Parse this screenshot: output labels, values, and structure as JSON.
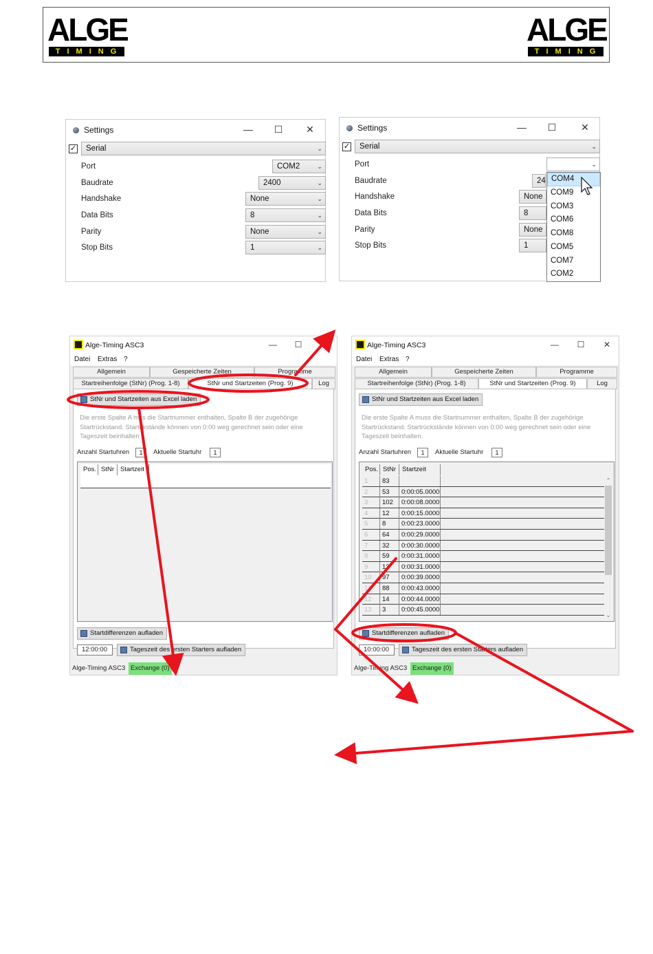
{
  "brand": {
    "logo_word": "ALGE",
    "logo_sub": "TIMING"
  },
  "settings_left": {
    "title": "Settings",
    "connection": "Serial",
    "port_label": "Port",
    "port_value": "COM2",
    "baud_label": "Baudrate",
    "baud_value": "2400",
    "handshake_label": "Handshake",
    "handshake_value": "None",
    "databits_label": "Data Bits",
    "databits_value": "8",
    "parity_label": "Parity",
    "parity_value": "None",
    "stopbits_label": "Stop Bits",
    "stopbits_value": "1"
  },
  "settings_right": {
    "title": "Settings",
    "connection": "Serial",
    "port_label": "Port",
    "port_value": "",
    "baud_label": "Baudrate",
    "baud_value": "24",
    "handshake_label": "Handshake",
    "handshake_value": "None",
    "databits_label": "Data Bits",
    "databits_value": "8",
    "parity_label": "Parity",
    "parity_value": "None",
    "stopbits_label": "Stop Bits",
    "stopbits_value": "1",
    "port_options": [
      "COM4",
      "COM9",
      "COM3",
      "COM6",
      "COM8",
      "COM5",
      "COM7",
      "COM2"
    ],
    "port_selected": "COM4"
  },
  "asc3": {
    "title": "Alge-Timing ASC3",
    "menu": [
      "Datei",
      "Extras",
      "?"
    ],
    "tabs_top": [
      "Allgemein",
      "Gespeicherte Zeiten",
      "Programme"
    ],
    "tabs_bottom": [
      "Startreihenfolge (StNr) (Prog. 1-8)",
      "StNr und Startzeiten (Prog. 9)",
      "Log"
    ],
    "load_excel": "StNr und Startzeiten aus Excel laden",
    "info_text": "Die erste Spalte A muss die Startnummer enthalten, Spalte B der zugehörige Startrückstand. Startrückstände können von 0:00 weg gerechnet sein oder eine Tageszeit beinhalten.",
    "starter_count_label": "Anzahl Startuhren",
    "starter_count_value": "1",
    "current_starter_label": "Aktuelle Startuhr",
    "current_starter_value": "1",
    "col_pos": "Pos.",
    "col_stnr": "StNr",
    "col_time": "Startzeit",
    "upload_diffs": "Startdifferenzen aufladen",
    "upload_daytime": "Tageszeit des ersten Starters aufladen",
    "status_app": "Alge-Timing ASC3",
    "status_exchange": "Exchange (0)"
  },
  "asc_left": {
    "time_value": "12:00:00",
    "info_partial_1": "Die erste Spalte A m",
    "info_partial_2": "ss die Startnummer enthalten, Spalte B der zugehörige",
    "info_partial_3": "Startrückstand. Start",
    "info_partial_4": "ckstände können von 0:00 weg gerechnet sein oder eine",
    "info_partial_5": "Tageszeit beinhalten",
    "starter_count_value": "1"
  },
  "asc_right": {
    "time_value": "10:00:00",
    "rows": [
      {
        "pos": "1",
        "stnr": "83",
        "time": ""
      },
      {
        "pos": "2",
        "stnr": "53",
        "time": "0:00:05.0000"
      },
      {
        "pos": "3",
        "stnr": "102",
        "time": "0:00:08.0000"
      },
      {
        "pos": "4",
        "stnr": "12",
        "time": "0:00:15.0000"
      },
      {
        "pos": "5",
        "stnr": "8",
        "time": "0:00:23.0000"
      },
      {
        "pos": "6",
        "stnr": "64",
        "time": "0:00:29.0000"
      },
      {
        "pos": "7",
        "stnr": "32",
        "time": "0:00:30.0000"
      },
      {
        "pos": "8",
        "stnr": "59",
        "time": "0:00:31.0000"
      },
      {
        "pos": "9",
        "stnr": "13",
        "time": "0:00:31.0000"
      },
      {
        "pos": "10",
        "stnr": "97",
        "time": "0:00:39.0000"
      },
      {
        "pos": "11",
        "stnr": "88",
        "time": "0:00:43.0000"
      },
      {
        "pos": "12",
        "stnr": "14",
        "time": "0:00:44.0000"
      },
      {
        "pos": "13",
        "stnr": "3",
        "time": "0:00:45.0000"
      }
    ]
  },
  "colors": {
    "annotation": "#e8141e",
    "exchange_bg": "#7be07b",
    "dropdown_highlight": "#cce8ff"
  }
}
